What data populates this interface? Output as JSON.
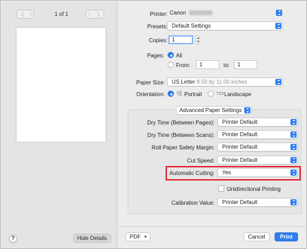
{
  "preview": {
    "page_count": "1 of 1",
    "nav_first": "《",
    "nav_prev": "〈",
    "nav_next": "〉",
    "nav_last": "》"
  },
  "left_footer": {
    "help_label": "?",
    "hide_details_label": "Hide Details"
  },
  "printer": {
    "label": "Printer:",
    "value": "Canon"
  },
  "presets": {
    "label": "Presets:",
    "value": "Default Settings"
  },
  "copies": {
    "label": "Copies:",
    "value": "1"
  },
  "pages": {
    "label": "Pages:",
    "all_label": "All",
    "from_label": "From:",
    "from_value": "1",
    "to_label": "to:",
    "to_value": "1",
    "selected": "All"
  },
  "paper_size": {
    "label": "Paper Size:",
    "value": "US Letter",
    "dimensions": "8.50 by 11.00 inches"
  },
  "orientation": {
    "label": "Orientation:",
    "portrait_label": "Portrait",
    "landscape_label": "Landscape",
    "selected": "Portrait"
  },
  "section": {
    "label": "Advanced Paper Settings"
  },
  "settings": [
    {
      "label": "Dry Time (Between Pages):",
      "value": "Printer Default"
    },
    {
      "label": "Dry Time (Between Scans):",
      "value": "Printer Default"
    },
    {
      "label": "Roll Paper Safety Margin:",
      "value": "Printer Default"
    },
    {
      "label": "Cut Speed:",
      "value": "Printer Default"
    },
    {
      "label": "Automatic Cutting:",
      "value": "Yes"
    }
  ],
  "unidirectional": {
    "label": "Unidirectional Printing",
    "checked": false
  },
  "calibration": {
    "label": "Calibration Value:",
    "value": "Printer Default"
  },
  "footer": {
    "pdf_label": "PDF",
    "cancel_label": "Cancel",
    "print_label": "Print"
  },
  "colors": {
    "accent": "#2f7ff0",
    "highlight": "#e0232e",
    "background": "#ececec"
  },
  "icons": {
    "dropdown": "stepper-icon",
    "portrait": "portrait-orientation-icon",
    "landscape": "landscape-orientation-icon"
  }
}
